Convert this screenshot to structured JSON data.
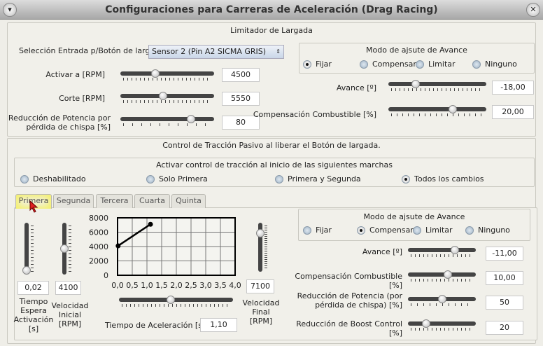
{
  "window": {
    "title": "Configuraciones para Carreras de Aceleración (Drag Racing)",
    "menu_icon": "chevron-down-icon",
    "close_icon": "close-icon"
  },
  "launch": {
    "title": "Limitador de Largada",
    "input_label": "Selección Entrada p/Botón de largada",
    "input_value": "Sensor 2 (Pin A2 SICMA GRIS)",
    "activate": {
      "label": "Activar a [RPM]",
      "value": "4500",
      "level": 0.36
    },
    "cut": {
      "label": "Corte [RPM]",
      "value": "5550",
      "level": 0.45
    },
    "power": {
      "label1": "Reducción de Potencia por",
      "label2": "pérdida de chispa [%]",
      "value": "80",
      "level": 0.78
    },
    "mode": {
      "title": "Modo de ajsute de Avance",
      "options": [
        "Fijar",
        "Compensar",
        "Limitar",
        "Ninguno"
      ],
      "selected": 0
    },
    "advance": {
      "label": "Avance [º]",
      "value": "-18,00",
      "level": 0.26
    },
    "fuel": {
      "label": "Compensación Combustible [%]",
      "value": "20,00",
      "level": 0.67
    }
  },
  "traction": {
    "title": "Control de Tracción Pasivo al liberar el Botón de largada.",
    "gears": {
      "title": "Activar control de tracción al inicio de las siguientes marchas",
      "options": [
        "Deshabilitado",
        "Solo Primera",
        "Primera y Segunda",
        "Todos los cambios"
      ],
      "selected": 3
    },
    "tabs": [
      "Primera",
      "Segunda",
      "Tercera",
      "Cuarta",
      "Quinta"
    ],
    "active_tab": 0,
    "wait": {
      "l1": "Tiempo",
      "l2": "Espera",
      "l3": "Activación",
      "l4": "[s]",
      "value": "0,02",
      "level": 0
    },
    "start_speed": {
      "l1": "Velocidad",
      "l2": "Inicial",
      "l3": "[RPM]",
      "value": "4100",
      "level": 0.5
    },
    "end_speed": {
      "l1": "Velocidad",
      "l2": "Final",
      "l3": "[RPM]",
      "value": "7100",
      "level": 0.85
    },
    "accel": {
      "label": "Tiempo de Aceleración [s]",
      "value": "1,10",
      "level": 0.45
    },
    "mode": {
      "title": "Modo de ajsute de Avance",
      "options": [
        "Fijar",
        "Compensar",
        "Limitar",
        "Ninguno"
      ],
      "selected": 1
    },
    "advance": {
      "label": "Avance [º]",
      "value": "-11,00",
      "level": 0.72
    },
    "fuel": {
      "label": "Compensación Combustible [%]",
      "value": "10,00",
      "level": 0.6
    },
    "power": {
      "label1": "Reducción de Potencia (por",
      "label2": "pérdida de chispa) [%]",
      "value": "50",
      "level": 0.5
    },
    "boost": {
      "label1": "Reducción de Boost Control",
      "label2": "[%]",
      "value": "20",
      "level": 0.24
    }
  },
  "chart_data": {
    "type": "line",
    "x": [
      0.02,
      1.12
    ],
    "y": [
      4100,
      7100
    ],
    "xlim": [
      0,
      4
    ],
    "ylim": [
      0,
      8000
    ],
    "xticks": [
      "0,0",
      "0,5",
      "1,0",
      "1,5",
      "2,0",
      "2,5",
      "3,0",
      "3,5",
      "4,0"
    ],
    "yticks": [
      "8000",
      "6000",
      "4000",
      "2000",
      "0"
    ],
    "grid": true
  }
}
